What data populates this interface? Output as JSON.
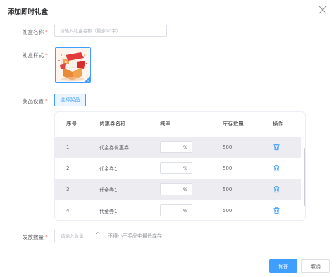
{
  "dialog": {
    "title": "添加即时礼盒",
    "close_icon": "close-icon"
  },
  "form": {
    "required_mark": "*",
    "name_label": "礼盒名称",
    "name_placeholder": "请输入礼盒名称（最多10字）",
    "style_label": "礼盒样式",
    "style_selected": true,
    "prize_label": "奖品设置",
    "select_prize_button": "选择奖品",
    "quantity_label": "发放数量",
    "quantity_placeholder": "请输入数量",
    "quantity_hint": "不得小于奖品中最低库存"
  },
  "table": {
    "columns": [
      "序号",
      "优惠券名称",
      "概率",
      "库存数量",
      "操作"
    ],
    "percent_suffix": "%",
    "delete_icon": "trash-icon",
    "rows": [
      {
        "index": "1",
        "name": "代金券优惠券...",
        "probability": "",
        "stock": "500"
      },
      {
        "index": "2",
        "name": "代金券1",
        "probability": "",
        "stock": "500"
      },
      {
        "index": "3",
        "name": "代金券1",
        "probability": "",
        "stock": "500"
      },
      {
        "index": "4",
        "name": "代金券1",
        "probability": "",
        "stock": "500"
      }
    ]
  },
  "footer": {
    "save_button": "保存",
    "cancel_button": "取消"
  },
  "colors": {
    "primary": "#409eff",
    "required": "#f56c6c",
    "row_stripe": "#ececf1"
  }
}
